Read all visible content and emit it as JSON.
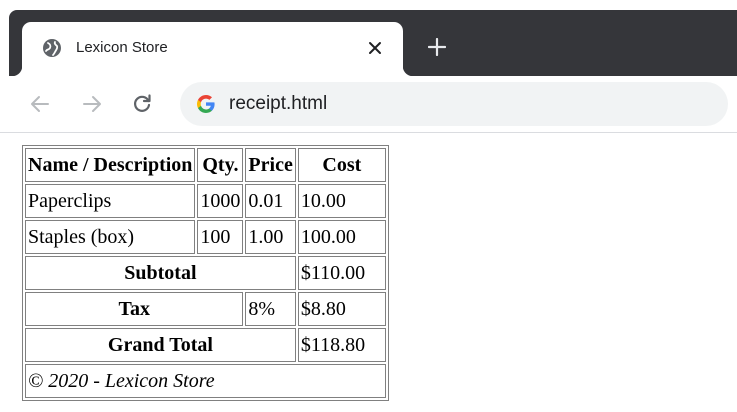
{
  "browser": {
    "tab": {
      "title": "Lexicon Store",
      "favicon": "globe-icon"
    },
    "new_tab_symbol": "+",
    "address_bar": {
      "url": "receipt.html"
    },
    "colors": {
      "tabstrip": "#35363a",
      "omnibox": "#f1f3f4"
    }
  },
  "receipt": {
    "headers": [
      "Name / Description",
      "Qty.",
      "Price",
      "Cost"
    ],
    "items": [
      {
        "name": "Paperclips",
        "qty": "1000",
        "price": "0.01",
        "cost": "10.00"
      },
      {
        "name": "Staples (box)",
        "qty": "100",
        "price": "1.00",
        "cost": "100.00"
      }
    ],
    "subtotal": {
      "label": "Subtotal",
      "value": "$110.00"
    },
    "tax": {
      "label": "Tax",
      "rate": "8%",
      "value": "$8.80"
    },
    "grand_total": {
      "label": "Grand Total",
      "value": "$118.80"
    },
    "footer": "© 2020 - Lexicon Store"
  }
}
